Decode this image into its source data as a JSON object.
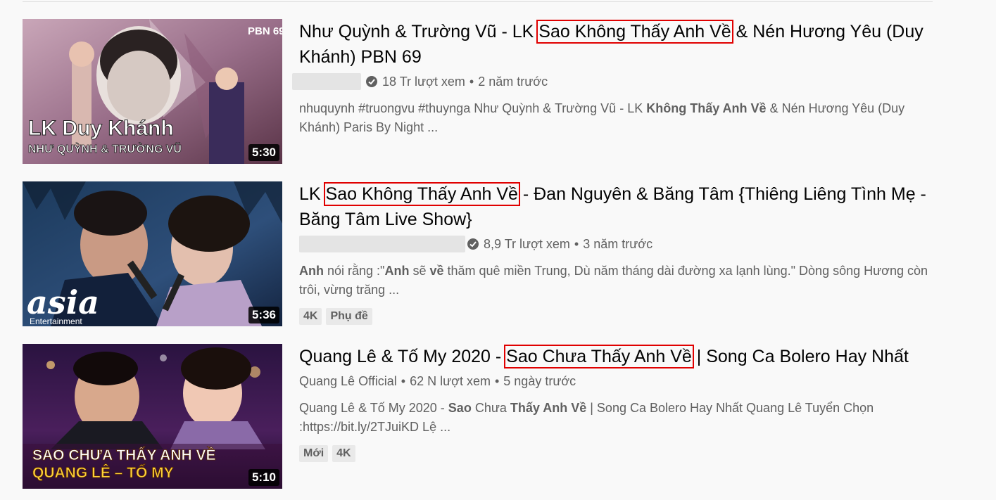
{
  "results": [
    {
      "title_pre": "Như Quỳnh & Trường Vũ - LK ",
      "title_hl": "Sao Không Thấy Anh Về",
      "title_post": " & Nén Hương Yêu (Duy Khánh) PBN 69",
      "views": "18 Tr lượt xem",
      "age": "2 năm trước",
      "desc_parts": [
        "nhuquynh #truongvu #thuynga Như Quỳnh & Trường Vũ - LK ",
        "Không Thấy Anh Về",
        " & Nén Hương Yêu (Duy Khánh) Paris By Night ..."
      ],
      "duration": "5:30",
      "thumb_text_1": "LK Duy Khánh",
      "thumb_text_2": "NHƯ QUỲNH & TRƯỜNG VŨ",
      "thumb_corner": "PBN 69"
    },
    {
      "title_pre": "LK ",
      "title_hl": "Sao Không Thấy Anh Về",
      "title_post": " - Đan Nguyên & Băng Tâm {Thiêng Liêng Tình Mẹ - Băng Tâm Live Show}",
      "views": "8,9 Tr lượt xem",
      "age": "3 năm trước",
      "desc_parts": [
        "Anh",
        " nói rằng :\"",
        "Anh",
        " sẽ ",
        "về",
        " thăm quê miền Trung, Dù năm tháng dài đường xa lạnh lùng.\" Dòng sông Hương còn trôi, vừng trăng ..."
      ],
      "duration": "5:36",
      "badges": [
        "4K",
        "Phụ đề"
      ],
      "thumb_logo": "asia",
      "thumb_logo_sub": "Entertainment"
    },
    {
      "title_pre": "Quang Lê & Tố My 2020 - ",
      "title_hl": "Sao Chưa Thấy Anh Về",
      "title_post": " | Song Ca Bolero Hay Nhất",
      "channel": "Quang Lê Official",
      "views": "62 N lượt xem",
      "age": "5 ngày trước",
      "desc_parts": [
        "Quang Lê & Tố My 2020 - ",
        "Sao",
        " Chưa ",
        "Thấy Anh Về",
        " | Song Ca Bolero Hay Nhất Quang Lê Tuyển Chọn :https://bit.ly/2TJuiKD Lệ ..."
      ],
      "duration": "5:10",
      "badges": [
        "Mới",
        "4K"
      ],
      "thumb_text_1": "SAO CHƯA THẤY ANH VỀ",
      "thumb_text_2": "QUANG LÊ – TỐ MY"
    }
  ],
  "sep": "•",
  "colors": {
    "highlight_box": "#e00000",
    "meta_text": "#606060",
    "title_text": "#030303"
  },
  "icons": {
    "verified": "verified-check-icon"
  }
}
